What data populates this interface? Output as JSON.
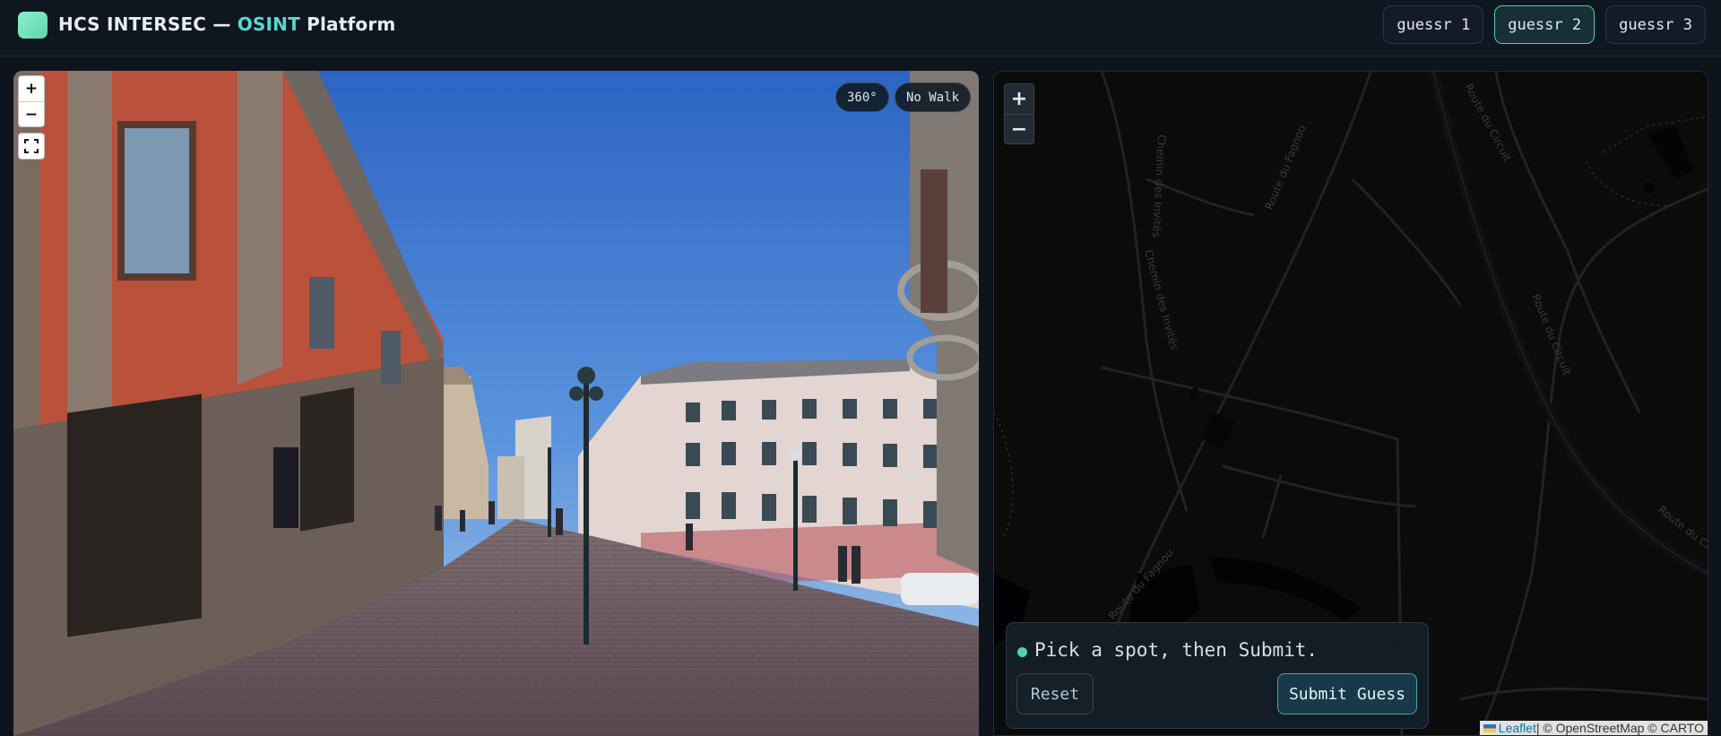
{
  "header": {
    "brand_prefix": "HCS INTERSEC — ",
    "brand_accent": "OSINT",
    "brand_suffix": " Platform",
    "tabs": [
      {
        "label": "guessr 1",
        "active": false
      },
      {
        "label": "guessr 2",
        "active": true
      },
      {
        "label": "guessr 3",
        "active": false
      }
    ]
  },
  "pano": {
    "zoom_in": "+",
    "zoom_out": "−",
    "badge_360": "360°",
    "badge_walk": "No Walk"
  },
  "map": {
    "zoom_in": "+",
    "zoom_out": "−",
    "road_labels": [
      "Route du Circuit",
      "Route du Circuit",
      "Route du Circuit",
      "Route du Fagnou",
      "Route du Fagnou",
      "Chemin des Invités",
      "Chemin des Invités"
    ],
    "guess": {
      "hint": "Pick a spot, then Submit.",
      "reset_label": "Reset",
      "submit_label": "Submit Guess"
    },
    "attribution": {
      "leaflet": "Leaflet",
      "rest": " | © OpenStreetMap © CARTO"
    }
  },
  "colors": {
    "accent": "#56d9cf",
    "status_dot": "#4fd1b2",
    "tab_active_border": "#4fc9c2"
  }
}
